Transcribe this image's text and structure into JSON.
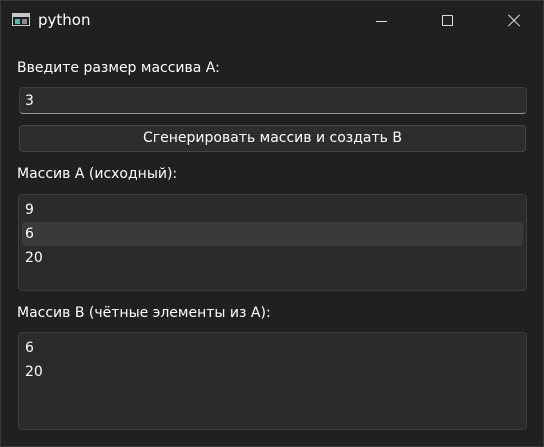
{
  "window": {
    "title": "python",
    "icon": "app-window-icon"
  },
  "form": {
    "size_label": "Введите размер массива A:",
    "size_value": "3",
    "generate_button": "Сгенерировать массив и создать B"
  },
  "array_a": {
    "label": "Массив A (исходный):",
    "items": [
      "9",
      "6",
      "20"
    ],
    "hovered_index": 1
  },
  "array_b": {
    "label": "Массив B (чётные элементы из A):",
    "items": [
      "6",
      "20"
    ]
  },
  "colors": {
    "window_bg": "#202020",
    "control_bg": "#2d2d2d",
    "hover_row": "#3a3a3a",
    "text": "#ffffff"
  }
}
